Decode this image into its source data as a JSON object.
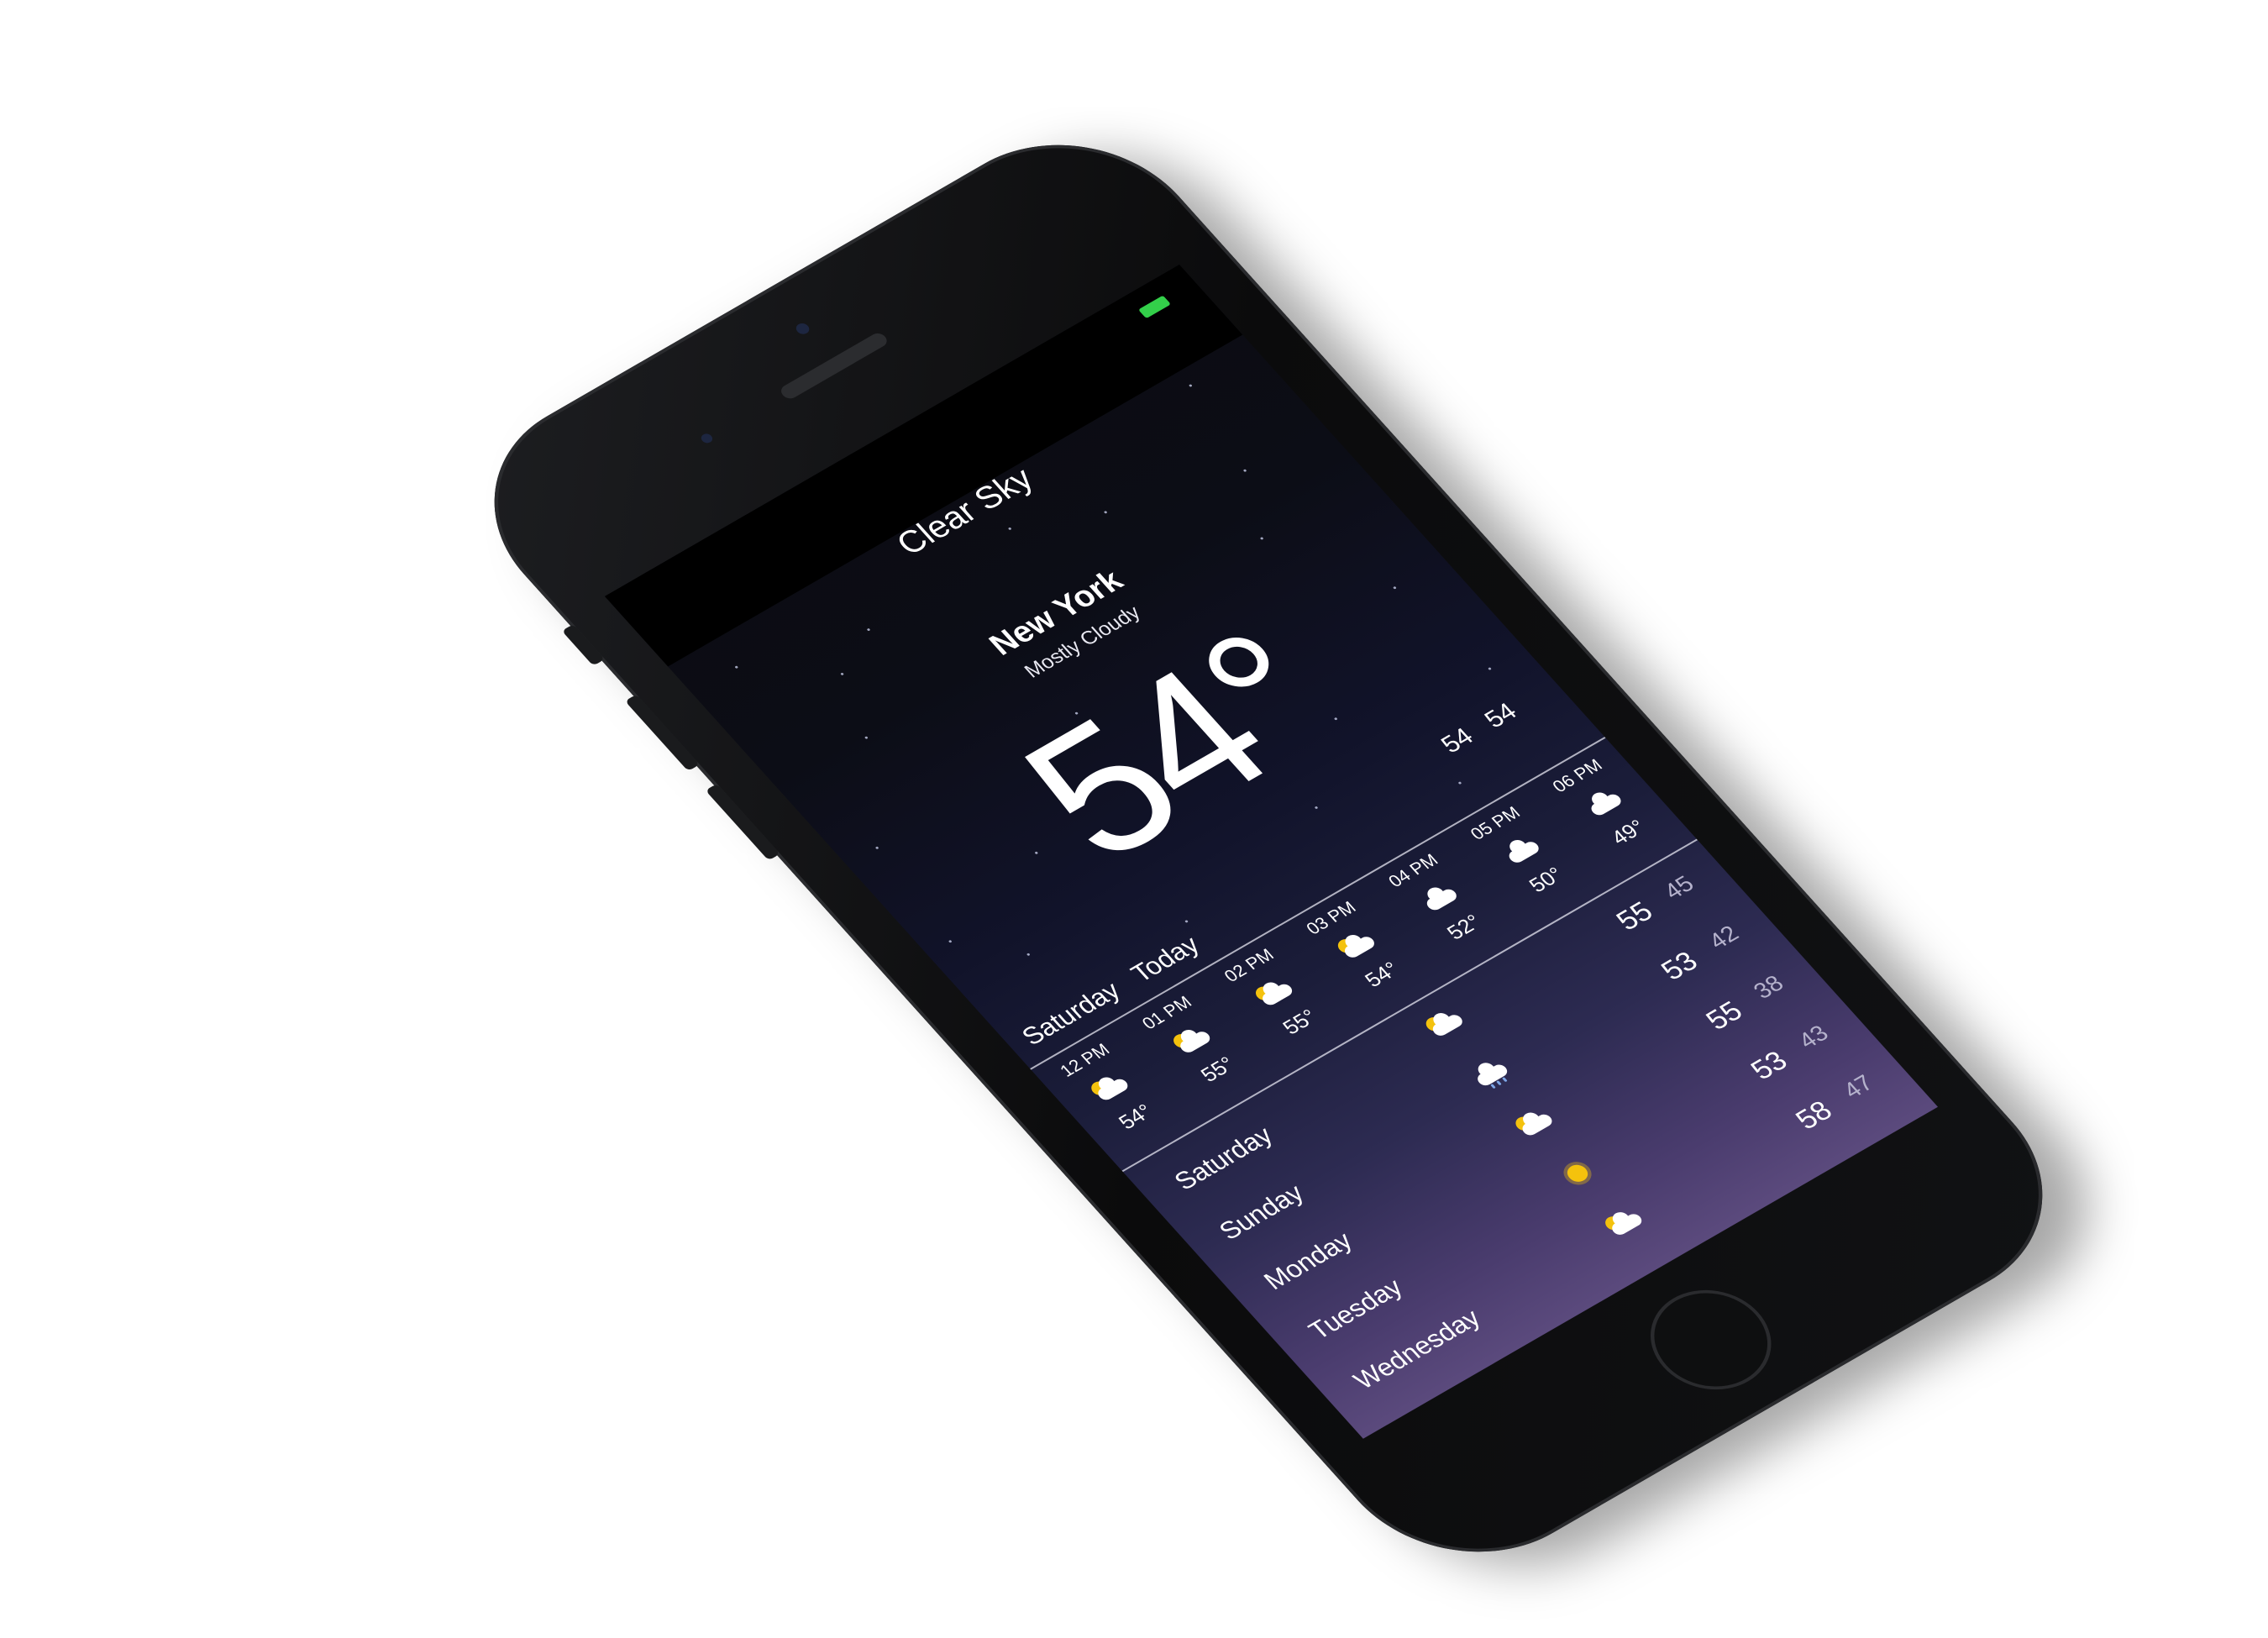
{
  "app_title": "Clear Sky",
  "location": {
    "city": "New York",
    "condition": "Mostly Cloudy"
  },
  "current": {
    "temperature": "54°",
    "high": "54",
    "low": "54"
  },
  "today": {
    "day": "Saturday",
    "label": "Today"
  },
  "hourly": [
    {
      "time": "12 PM",
      "icon": "partly-cloudy-icon",
      "temp": "54°"
    },
    {
      "time": "01 PM",
      "icon": "partly-cloudy-icon",
      "temp": "55°"
    },
    {
      "time": "02 PM",
      "icon": "partly-cloudy-icon",
      "temp": "55°"
    },
    {
      "time": "03 PM",
      "icon": "partly-cloudy-icon",
      "temp": "54°"
    },
    {
      "time": "04 PM",
      "icon": "cloud-icon",
      "temp": "52°"
    },
    {
      "time": "05 PM",
      "icon": "cloud-icon",
      "temp": "50°"
    },
    {
      "time": "06 PM",
      "icon": "cloud-icon",
      "temp": "49°"
    }
  ],
  "daily": [
    {
      "day": "Saturday",
      "icon": "partly-cloudy-icon",
      "high": "55",
      "low": "45"
    },
    {
      "day": "Sunday",
      "icon": "rain-cloud-icon",
      "high": "53",
      "low": "42"
    },
    {
      "day": "Monday",
      "icon": "partly-cloudy-icon",
      "high": "55",
      "low": "38"
    },
    {
      "day": "Tuesday",
      "icon": "sun-icon",
      "high": "53",
      "low": "43"
    },
    {
      "day": "Wednesday",
      "icon": "partly-cloudy-icon",
      "high": "58",
      "low": "47"
    }
  ],
  "colors": {
    "battery": "#33d04a",
    "sun": "#f4c20d",
    "sky_top": "#0b0c12",
    "sky_bottom": "#5b4a7d"
  }
}
